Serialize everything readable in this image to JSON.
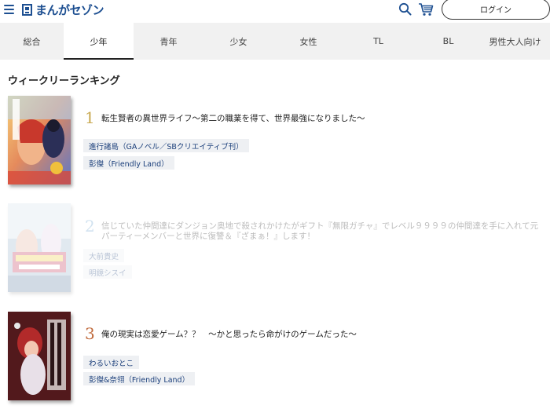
{
  "header": {
    "logo_text": "まんがセゾン",
    "login_label": "ログイン"
  },
  "tabs": [
    "総合",
    "少年",
    "青年",
    "少女",
    "女性",
    "TL",
    "BL",
    "男性大人向け"
  ],
  "active_tab": "少年",
  "ranking": {
    "title": "ウィークリーランキング",
    "entries": [
      {
        "rank": "1",
        "title": "転生賢者の異世界ライフ〜第二の職業を得て、世界最強になりました〜",
        "author": "進行諸島（GAノベル／SBクリエイティブ刊）",
        "artist": "彭傑（Friendly Land）"
      },
      {
        "rank": "2",
        "title_line1": "信じていた仲間達にダンジョン奥地で殺されかけたがギフト『無限ガチャ』でレベル９９９９の仲間達を手に入れて元",
        "title_line2": "パーティーメンバーと世界に復讐＆『ざまぁ！』します！",
        "author": "大前貴史",
        "artist": "明鏡シスイ"
      },
      {
        "rank": "3",
        "title": "俺の現実は恋愛ゲーム？？　〜かと思ったら命がけのゲームだった〜",
        "author": "わるいおとこ",
        "artist": "彭傑&奈翎（Friendly Land）"
      }
    ]
  },
  "colors": {
    "brand": "#1d4f91",
    "rank_gold": "#c8a74e",
    "rank_bronze": "#c06a3c",
    "tag_bg": "#eef0f3"
  }
}
